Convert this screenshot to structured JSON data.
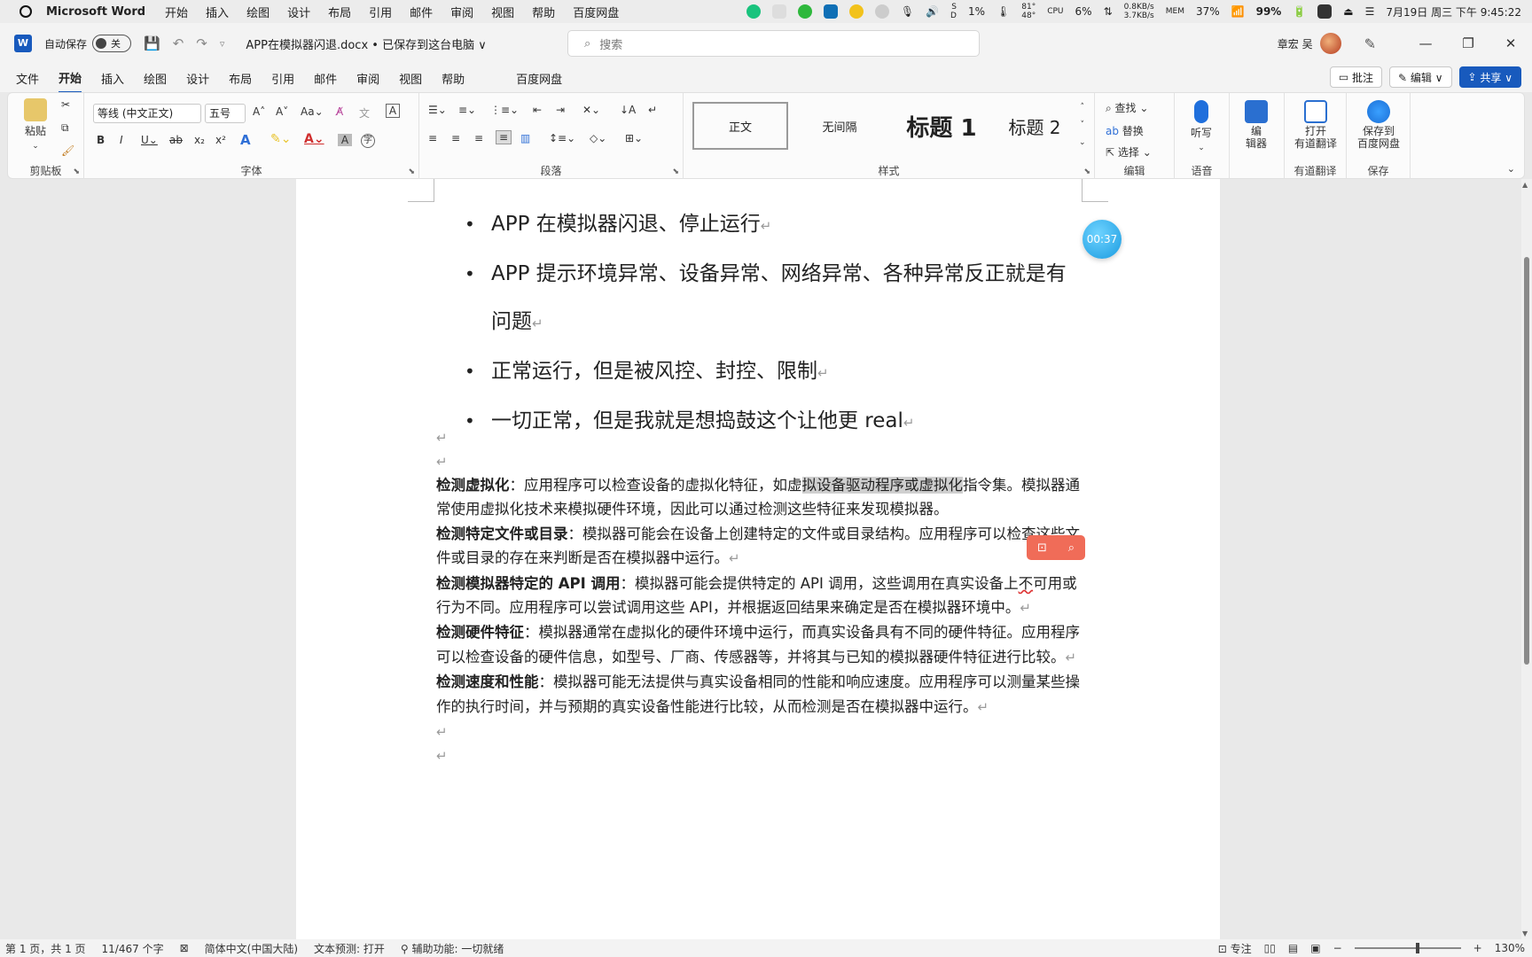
{
  "menubar": {
    "app_name": "Microsoft Word",
    "items": [
      "开始",
      "插入",
      "绘图",
      "设计",
      "布局",
      "引用",
      "邮件",
      "审阅",
      "视图",
      "帮助",
      "百度网盘"
    ],
    "tray": {
      "temp_hi": "81°",
      "temp_lo": "48°",
      "ssd_label": "S\nD",
      "ssd_value": "1%",
      "cpu_label": "CPU",
      "cpu_value": "6%",
      "net_up": "0.8KB/s",
      "net_down": "3.7KB/s",
      "mem_label": "MEM",
      "mem_value": "37%",
      "battery": "99%",
      "datetime": "7月19日 周三 下午 9:45:22"
    }
  },
  "titlebar": {
    "logo": "W",
    "autosave_label": "自动保存",
    "autosave_state": "关",
    "doc_title": "APP在模拟器闪退.docx • 已保存到这台电脑 ∨",
    "search_placeholder": "搜索",
    "user_name": "章宏 吴",
    "min": "—",
    "restore": "❐",
    "close": "✕"
  },
  "tabs": {
    "items": [
      "文件",
      "开始",
      "插入",
      "绘图",
      "设计",
      "布局",
      "引用",
      "邮件",
      "审阅",
      "视图",
      "帮助",
      "百度网盘"
    ],
    "active": "开始",
    "comment_btn": "批注",
    "edit_btn": "✎ 编辑 ∨",
    "share_btn": "共享 ∨"
  },
  "ribbon": {
    "clipboard": {
      "label": "剪贴板",
      "paste": "粘贴"
    },
    "font": {
      "label": "字体",
      "font_name": "等线 (中文正文)",
      "font_size": "五号"
    },
    "paragraph": {
      "label": "段落"
    },
    "styles": {
      "label": "样式",
      "items": [
        "正文",
        "无间隔",
        "标题 1",
        "标题 2"
      ]
    },
    "editing": {
      "label": "编辑",
      "find": "查找",
      "replace": "替换",
      "select": "选择"
    },
    "voice": {
      "label": "语音",
      "dictate": "听写"
    },
    "editor": {
      "label": "编\n辑器"
    },
    "youdao": {
      "label": "有道翻译",
      "open": "打开\n有道翻译"
    },
    "baidu": {
      "label": "保存",
      "save": "保存到\n百度网盘"
    }
  },
  "document": {
    "bullets": [
      "APP 在模拟器闪退、停止运行",
      "APP 提示环境异常、设备异常、网络异常、各种异常反正就是有问题",
      "正常运行，但是被风控、封控、限制",
      "一切正常，但是我就是想捣鼓这个让他更 real"
    ],
    "para_mark": "↵",
    "timer": "00:37",
    "items": [
      {
        "title": "检测虚拟化",
        "pre": "：应用程序可以检查设备的虚拟化特征，如虚",
        "hl": "拟设备驱动程序或虚拟化",
        "post": "指令集。模拟器通常使用虚拟化技术来模拟硬件环境，因此可以通过检测这些特征来发现模拟器。"
      },
      {
        "title": "检测特定文件或目录",
        "pre": "：模拟器可能会在设备上创建特定的文件或目录结构。应用程序可以检查这些文件或目录的存在来判断是否在模拟器中运行。",
        "hl": "",
        "post": ""
      },
      {
        "title": "检测模拟器特定的 API 调用",
        "pre": "：模拟器可能会提供特定的 API 调用，这些调用在真实设备上",
        "sq": "不",
        "post": "可用或行为不同。应用程序可以尝试调用这些 API，并根据返回结果来确定是否在模拟器环境中。"
      },
      {
        "title": "检测硬件特征",
        "pre": "：模拟器通常在虚拟化的硬件环境中运行，而真实设备具有不同的硬件特征。应用程序可以检查设备的硬件信息，如型号、厂商、传感器等，并将其与已知的模拟器硬件特征进行比较。",
        "hl": "",
        "post": ""
      },
      {
        "title": "检测速度和性能",
        "pre": "：模拟器可能无法提供与真实设备相同的性能和响应速度。应用程序可以测量某些操作的执行时间，并与预期的真实设备性能进行比较，从而检测是否在模拟器中运行。",
        "hl": "",
        "post": ""
      }
    ]
  },
  "statusbar": {
    "page": "第 1 页，共 1 页",
    "words": "11/467 个字",
    "language": "简体中文(中国大陆)",
    "prediction": "文本预测: 打开",
    "accessibility": "辅助功能: 一切就绪",
    "focus": "专注",
    "zoom": "130%",
    "zoom_level": 0.6
  },
  "colors": {
    "word_blue": "#185abd",
    "highlight": "#cfcfcf",
    "timer": "#1a9be0",
    "float_tools": "#f06c58"
  }
}
